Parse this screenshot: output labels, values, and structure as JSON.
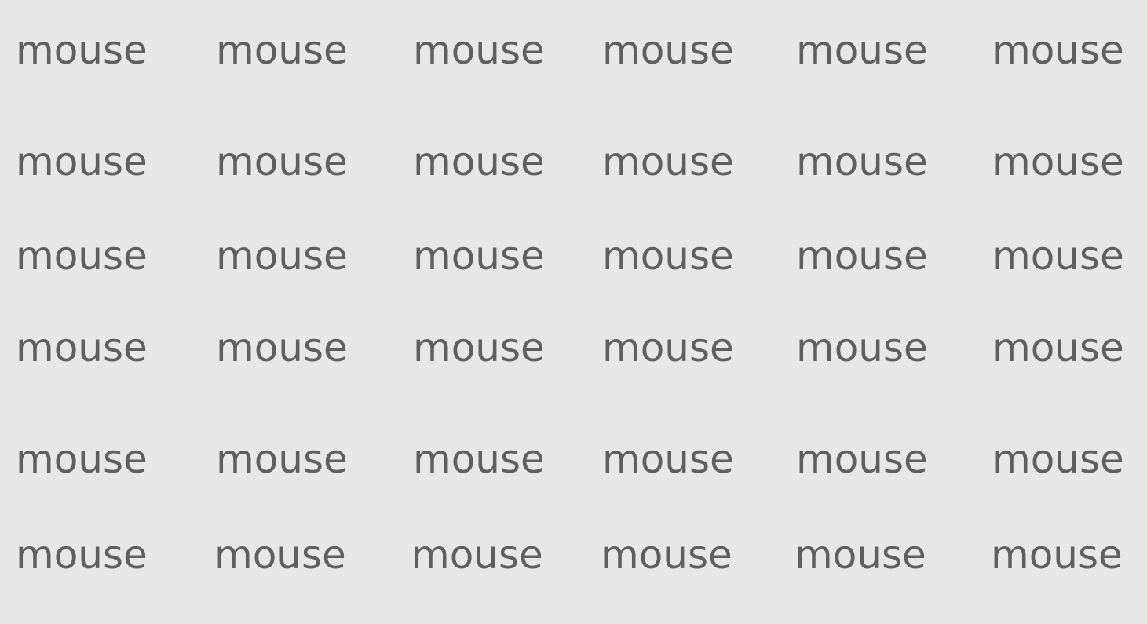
{
  "colors": {
    "background": "#e7e7e7",
    "text": "#5f5f5f"
  },
  "rows": [
    [
      "mouse",
      "mouse",
      "mouse",
      "mouse",
      "mouse",
      "mouse"
    ],
    [
      "mouse",
      "mouse",
      "mouse",
      "mouse",
      "mouse",
      "mouse"
    ],
    [
      "mouse",
      "mouse",
      "mouse",
      "mouse",
      "mouse",
      "mouse"
    ],
    [
      "mouse",
      "mouse",
      "mouse",
      "mouse",
      "mouse",
      "mouse"
    ],
    [
      "mouse",
      "mouse",
      "mouse",
      "mouse",
      "mouse",
      "mouse"
    ],
    [
      "mouse",
      "mouse",
      "mouse",
      "mouse",
      "mouse",
      "mouse"
    ]
  ]
}
